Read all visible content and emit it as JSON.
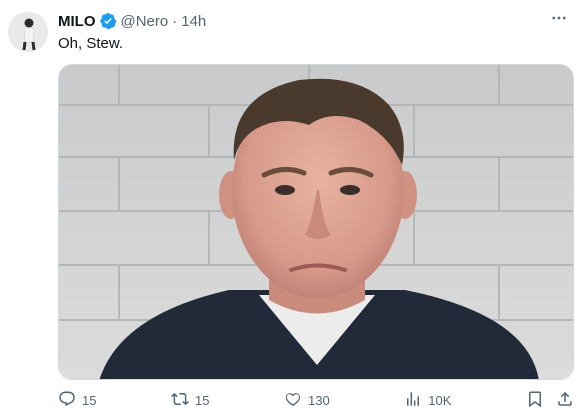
{
  "author": {
    "display_name": "MILO",
    "handle": "@Nero",
    "separator": "·",
    "timestamp": "14h",
    "verified": true,
    "verified_color": "#1d9bf0"
  },
  "tweet": {
    "text": "Oh, Stew."
  },
  "media": {
    "description_icon": "mugshot-photo"
  },
  "actions": {
    "reply_count": "15",
    "retweet_count": "15",
    "like_count": "130",
    "views_count": "10K"
  },
  "icons": [
    "more-icon",
    "reply-icon",
    "retweet-icon",
    "like-icon",
    "views-icon",
    "bookmark-icon",
    "share-icon",
    "verified-badge-icon"
  ],
  "colors": {
    "text": "#0f1419",
    "secondary": "#536471",
    "accent": "#1d9bf0"
  }
}
